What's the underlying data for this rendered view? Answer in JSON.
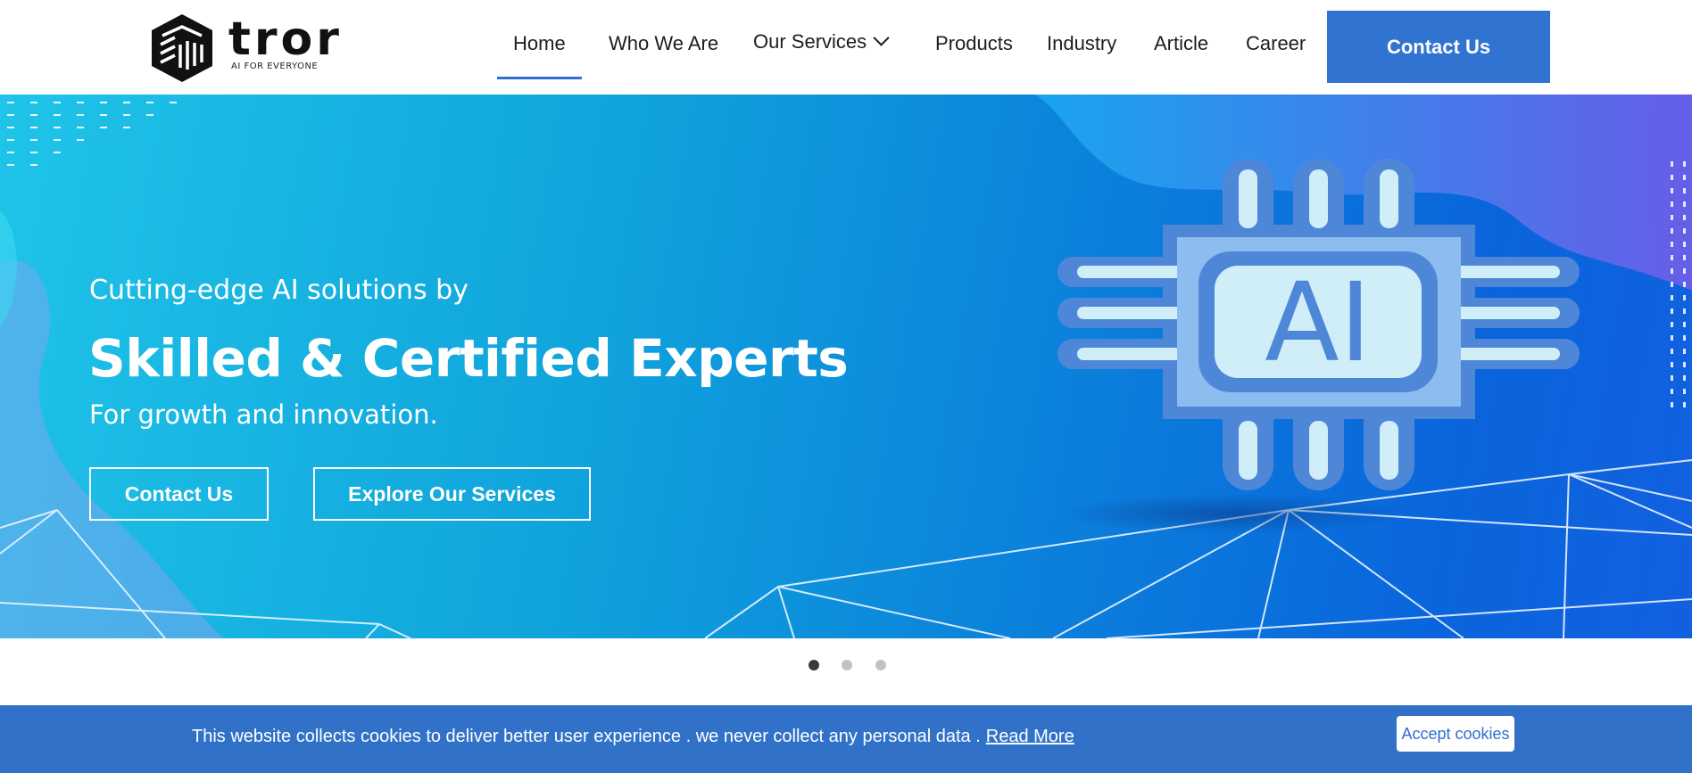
{
  "brand": {
    "name": "tror",
    "tagline": "AI FOR EVERYONE"
  },
  "nav": {
    "items": [
      {
        "label": "Home",
        "active": true
      },
      {
        "label": "Who We Are"
      },
      {
        "label": "Our Services",
        "has_dropdown": true
      },
      {
        "label": "Products"
      },
      {
        "label": "Industry"
      },
      {
        "label": "Article"
      },
      {
        "label": "Career"
      }
    ],
    "cta_label": "Contact Us"
  },
  "hero": {
    "subtitle": "Cutting-edge AI solutions by",
    "title": "Skilled & Certified Experts",
    "tagline": "For growth and innovation.",
    "buttons": [
      "Contact Us",
      "Explore Our Services"
    ],
    "chip_text": "AI"
  },
  "carousel": {
    "slide_count": 3,
    "active_index": 0
  },
  "cookie_bar": {
    "message": "This website collects cookies to deliver better user experience . we never collect any personal data .",
    "link_label": "Read More",
    "accept_label": "Accept cookies"
  },
  "colors": {
    "primary": "#3173d0",
    "hero_start": "#1fc4e8",
    "hero_end": "#0a65dc",
    "chip_outer": "#4f87d8",
    "chip_inner": "#cfeef7"
  },
  "icons": [
    "tror-logo-icon",
    "chevron-down-icon",
    "ai-chip-icon"
  ]
}
